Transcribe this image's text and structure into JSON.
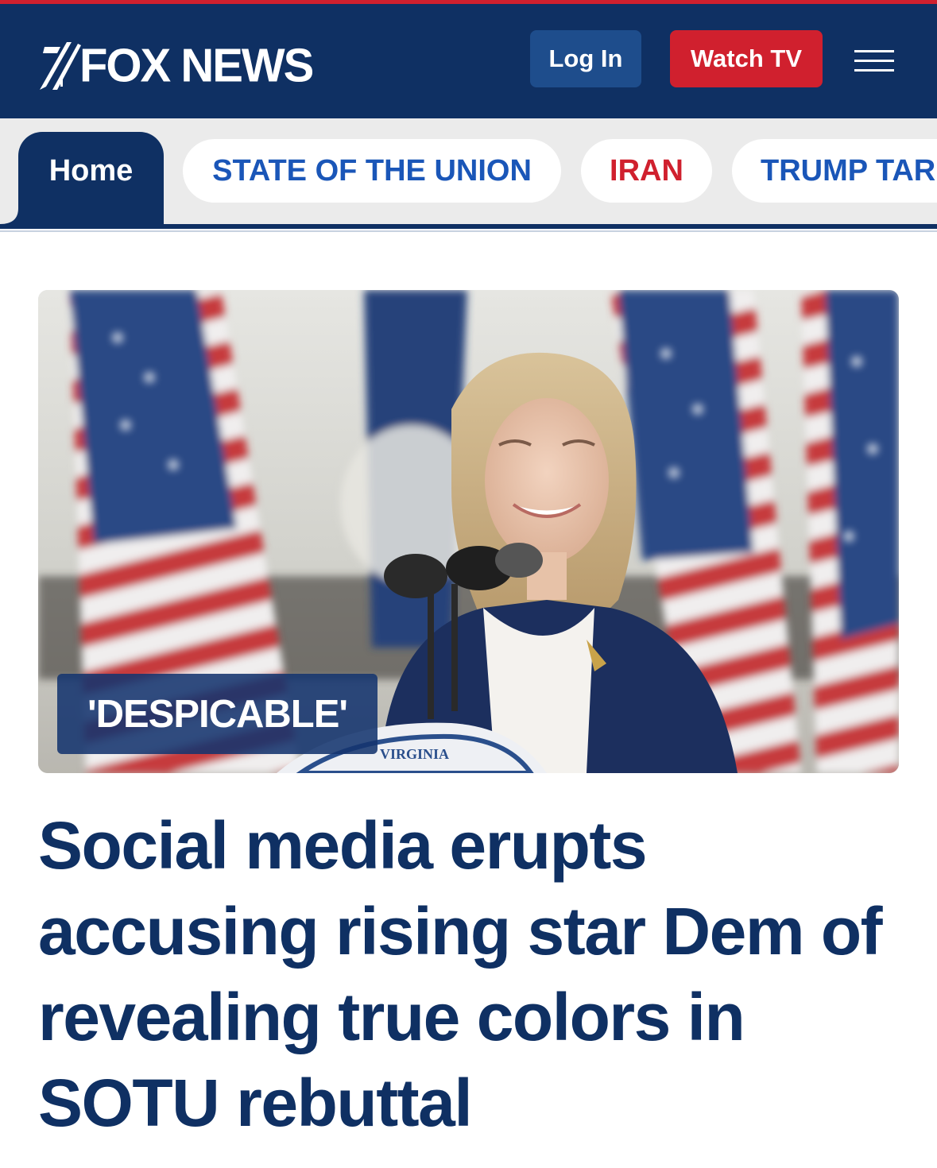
{
  "header": {
    "logo_text": "FOX NEWS",
    "login_label": "Log In",
    "watch_label": "Watch TV",
    "menu_icon": "hamburger-menu-icon",
    "colors": {
      "navy": "#0f3063",
      "red": "#d0202e",
      "login_blue": "#1e4d8c"
    }
  },
  "nav": {
    "tabs": [
      {
        "label": "Home",
        "active": true
      },
      {
        "label": "STATE OF THE UNION",
        "active": false
      },
      {
        "label": "IRAN",
        "active": false
      },
      {
        "label": "TRUMP TAR",
        "active": false
      }
    ],
    "colors": {
      "link_blue": "#1a56b8",
      "link_red": "#d0202e"
    }
  },
  "story": {
    "tag": "'DESPICABLE'",
    "headline": "Social media erupts accusing rising star Dem of revealing true colors in SOTU rebuttal",
    "image_seal_text": "VIRGINIA"
  }
}
